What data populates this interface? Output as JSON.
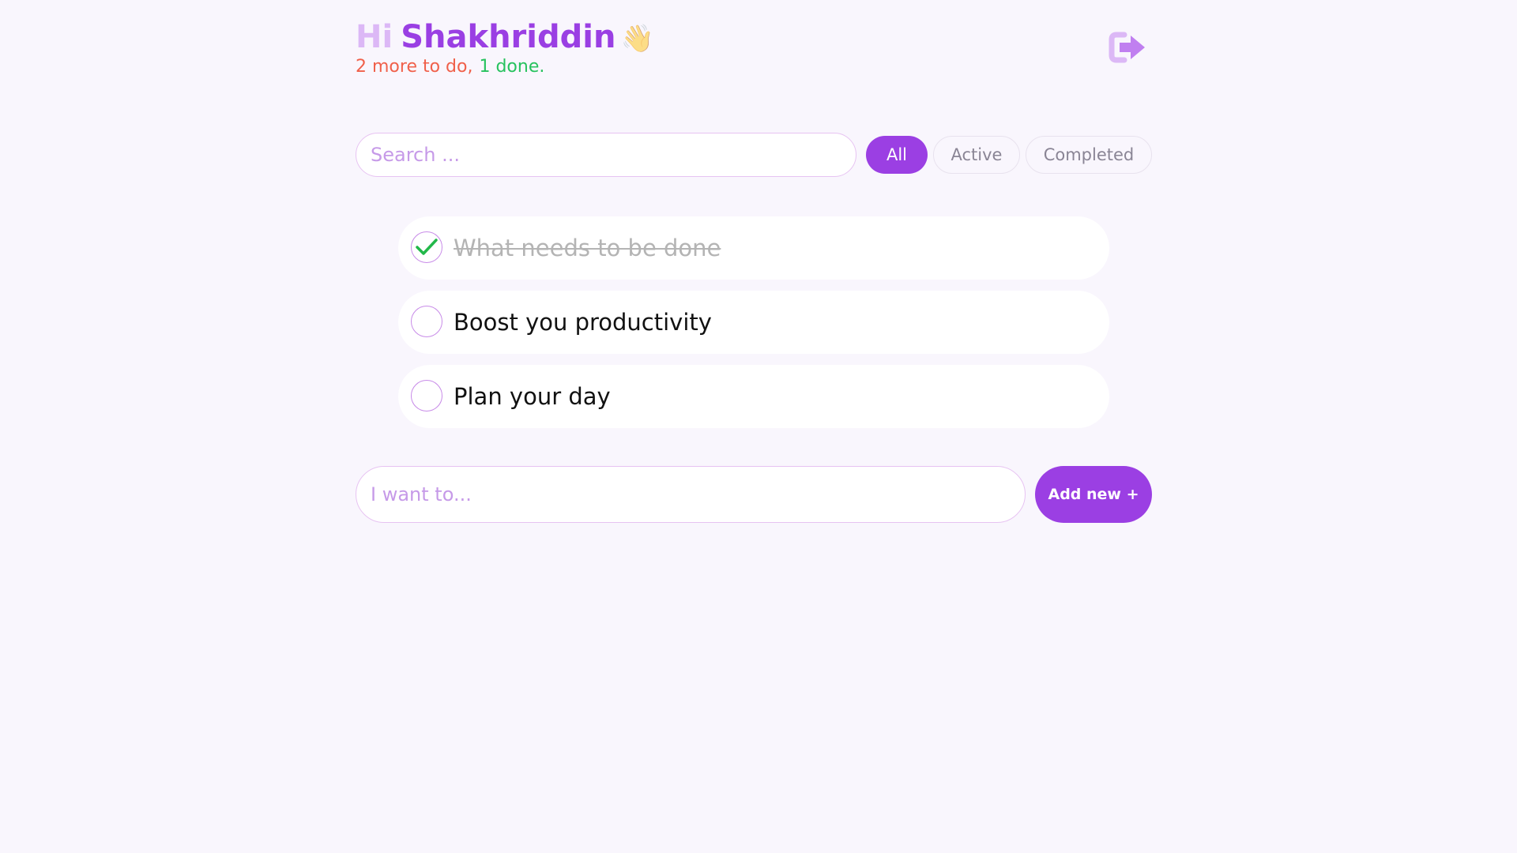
{
  "header": {
    "greeting_prefix": "Hi",
    "user_name": "Shakhriddin",
    "wave_emoji": "👋",
    "todo_summary": "2 more to do,",
    "done_summary": "1 done.",
    "logout_icon": "logout-arrow-icon"
  },
  "search": {
    "placeholder": "Search ...",
    "value": ""
  },
  "filters": {
    "all": "All",
    "active": "Active",
    "completed": "Completed",
    "selected": "All"
  },
  "todos": [
    {
      "text": "What needs to be done",
      "done": true
    },
    {
      "text": "Boost you productivity",
      "done": false
    },
    {
      "text": "Plan your day",
      "done": false
    }
  ],
  "add": {
    "placeholder": "I want to...",
    "value": "",
    "button_label": "Add new +"
  },
  "colors": {
    "accent": "#9b3fe3",
    "accent_light": "#dcb8f6",
    "todo_count": "#f0604a",
    "done_count": "#27c25e",
    "background": "#f9f6fd"
  }
}
